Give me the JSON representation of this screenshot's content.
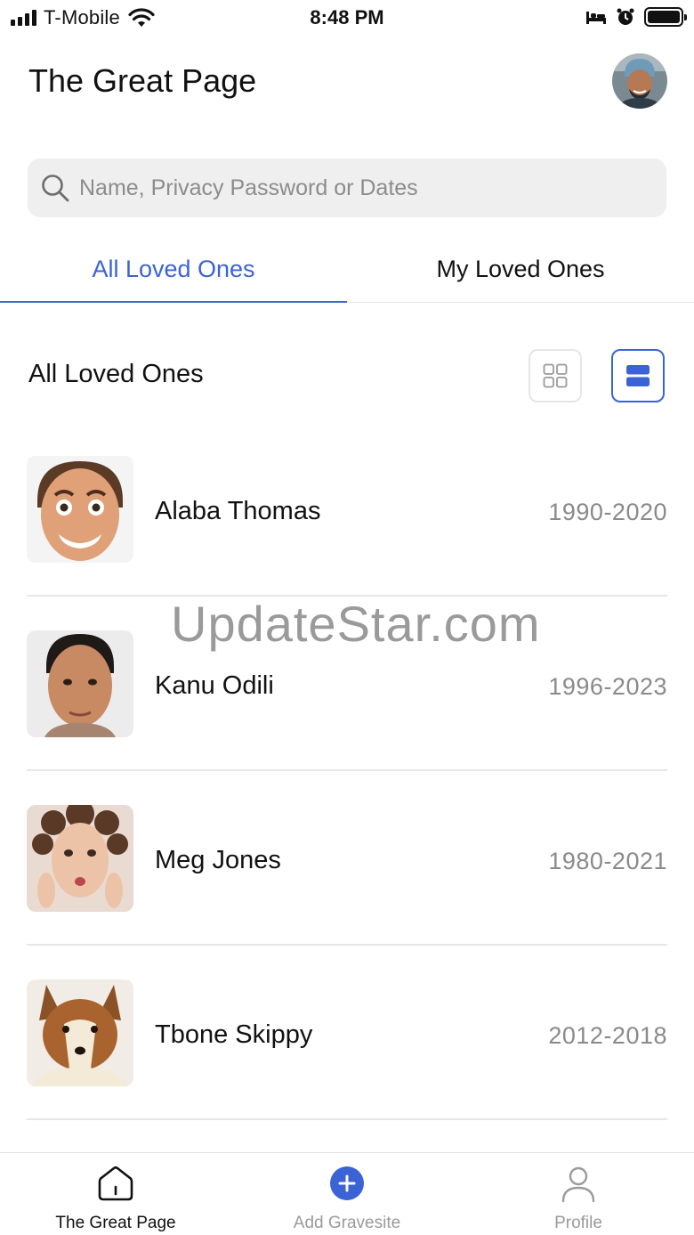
{
  "status_bar": {
    "carrier": "T-Mobile",
    "time": "8:48 PM",
    "icons": [
      "signal-icon",
      "wifi-icon",
      "bed-icon",
      "alarm-icon",
      "battery-icon"
    ]
  },
  "header": {
    "title": "The Great Page",
    "avatar_icon": "user-avatar"
  },
  "search": {
    "placeholder": "Name, Privacy Password or Dates",
    "value": "",
    "icon": "search-icon"
  },
  "tabs": [
    {
      "label": "All Loved Ones",
      "active": true
    },
    {
      "label": "My Loved Ones",
      "active": false
    }
  ],
  "section": {
    "title": "All Loved Ones",
    "view_modes": [
      "grid-view-icon",
      "list-view-icon"
    ],
    "selected_view": "list"
  },
  "loved_ones": [
    {
      "name": "Alaba Thomas",
      "dates": "1990-2020"
    },
    {
      "name": "Kanu Odili",
      "dates": "1996-2023"
    },
    {
      "name": "Meg Jones",
      "dates": "1980-2021"
    },
    {
      "name": "Tbone Skippy",
      "dates": "2012-2018"
    }
  ],
  "watermark": "UpdateStar.com",
  "bottom_nav": [
    {
      "label": "The Great Page",
      "icon": "home-icon",
      "active": true
    },
    {
      "label": "Add Gravesite",
      "icon": "add-icon",
      "active": false
    },
    {
      "label": "Profile",
      "icon": "profile-icon",
      "active": false
    }
  ],
  "colors": {
    "accent": "#3b63d6",
    "muted_text": "#8a8a8a",
    "search_bg": "#efefef"
  }
}
